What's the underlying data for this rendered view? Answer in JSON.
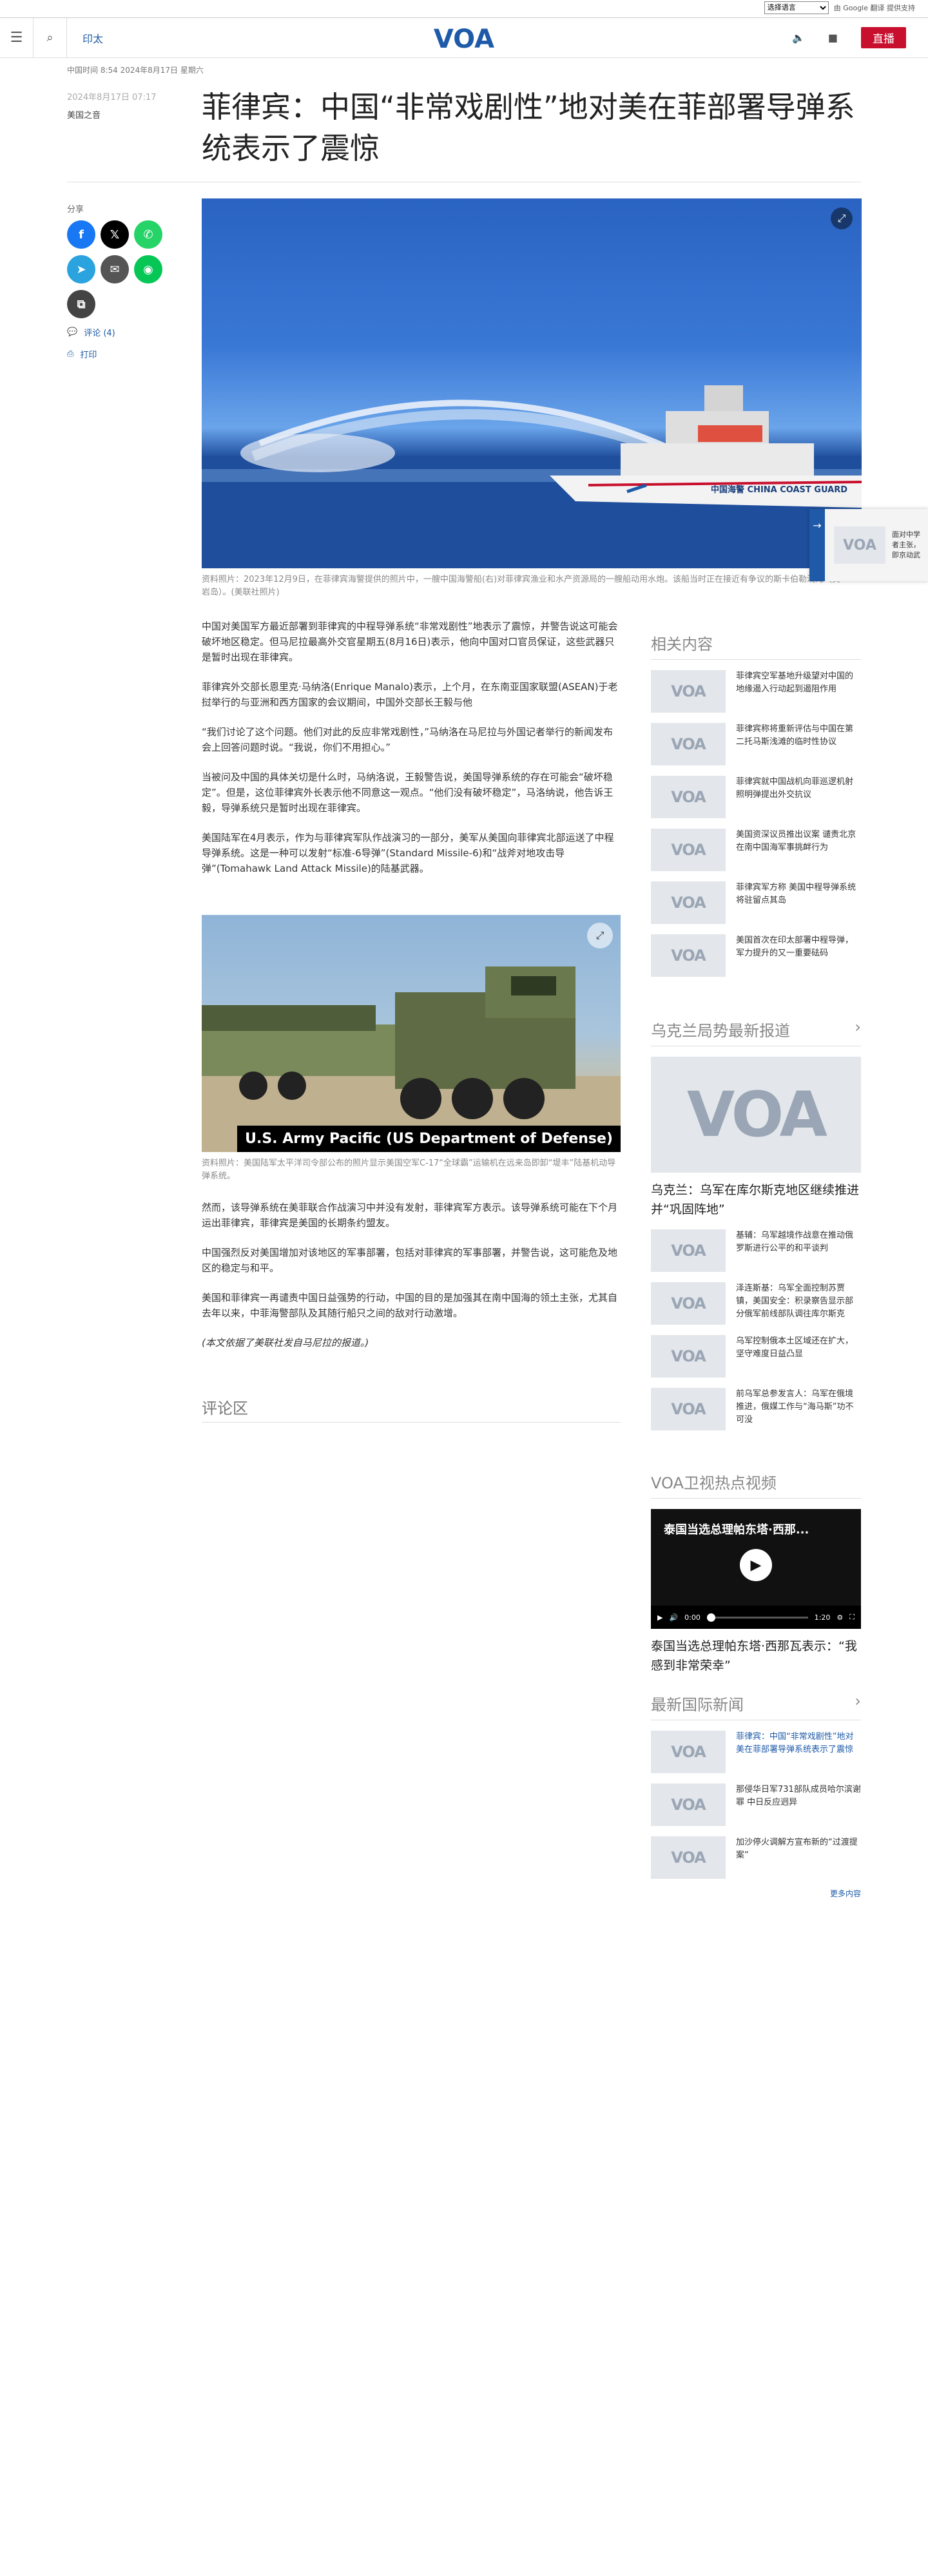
{
  "topbar": {
    "language_select": "选择语言",
    "translate_label": "由 Google 翻译 提供支持"
  },
  "header": {
    "section": "印太",
    "logo_text": "VOA",
    "live_label": "直播"
  },
  "article": {
    "dateline": "中国时间 8:54 2024年8月17日 星期六",
    "pub_date": "2024年8月17日 07:17",
    "author": "美国之音",
    "title": "菲律宾：中国“非常戏剧性”地对美在菲部署导弹系统表示了震惊",
    "share_label": "分享",
    "comments_link": "评论 (4)",
    "print_link": "打印",
    "hero_caption": "资料照片：2023年12月9日，在菲律宾海警提供的照片中，一艘中国海警船(右)对菲律宾渔业和水产资源局的一艘船动用水炮。该船当时正在接近有争议的斯卡伯勒浅滩（黄岩岛）。(美联社照片)",
    "hero_ship_label": "中国海警 CHINA COAST GUARD",
    "paragraphs": [
      "中国对美国军方最近部署到菲律宾的中程导弹系统“非常戏剧性”地表示了震惊，并警告说这可能会破坏地区稳定。但马尼拉最高外交官星期五(8月16日)表示，他向中国对口官员保证，这些武器只是暂时出现在菲律宾。",
      "菲律宾外交部长恩里克·马纳洛(Enrique Manalo)表示，上个月，在东南亚国家联盟(ASEAN)于老挝举行的与亚洲和西方国家的会议期间，中国外交部长王毅与他",
      "“我们讨论了这个问题。他们对此的反应非常戏剧性，”马纳洛在马尼拉与外国记者举行的新闻发布会上回答问题时说。“我说，你们不用担心。”",
      "当被问及中国的具体关切是什么时，马纳洛说，王毅警告说，美国导弹系统的存在可能会“破坏稳定”。但是，这位菲律宾外长表示他不同意这一观点。“他们没有破坏稳定”，马洛纳说，他告诉王毅，导弹系统只是暂时出现在菲律宾。",
      "美国陆军在4月表示，作为与菲律宾军队作战演习的一部分，美军从美国向菲律宾北部运送了中程导弹系统。这是一种可以发射“标准-6导弹”(Standard Missile-6)和“战斧对地攻击导弹”(Tomahawk Land Attack Missile)的陆基武器。"
    ],
    "inline_badge": "U.S. Army Pacific (US Department of Defense)",
    "inline_caption": "资料照片：美国陆军太平洋司令部公布的照片显示美国空军C-17“全球霸”运输机在远来岛即卸“堤丰”陆基机动导弹系统。",
    "paragraphs2": [
      "然而，该导弹系统在美菲联合作战演习中并没有发射，菲律宾军方表示。该导弹系统可能在下个月运出菲律宾，菲律宾是美国的长期条约盟友。",
      "中国强烈反对美国增加对该地区的军事部署，包括对菲律宾的军事部署，并警告说，这可能危及地区的稳定与和平。",
      "美国和菲律宾一再谴责中国日益强势的行动，中国的目的是加强其在南中国海的领土主张，尤其自去年以来，中菲海警部队及其随行船只之间的敌对行动激增。"
    ],
    "note": "(本文依据了美联社发自马尼拉的报道。)",
    "comments_title": "评论区"
  },
  "sidebar": {
    "related_title": "相关内容",
    "related": [
      "菲律宾空军基地升级望对中国的地缘遏入行动起到遏阻作用",
      "菲律宾称将重新评估与中国在第二托马斯浅滩的临时性协议",
      "菲律宾就中国战机向菲巡逻机射照明弹提出外交抗议",
      "美国资深议员推出议案 谴责北京在南中国海军事挑衅行为",
      "菲律宾军方称 美国中程导弹系统将驻留点其岛",
      "美国首次在印太部署中程导弹，军力提升的又一重要砝码"
    ],
    "ukraine_title": "乌克兰局势最新报道",
    "ukraine_lead": "乌克兰：乌军在库尔斯克地区继续推进并“巩固阵地”",
    "ukraine": [
      "基辅：乌军越境作战意在推动俄罗斯进行公平的和平谈判",
      "泽连斯基：乌军全面控制苏贾镇，美国安全：积录察告显示部分俄军前线部队调往库尔斯克",
      "乌军控制俄本土区域还在扩大，坚守难度日益凸显",
      "前乌军总参发言人：乌军在俄境推进，俄媒工作与“海马斯”功不可没"
    ],
    "video_title": "VOA卫视热点视频",
    "video_overlay": "泰国当选总理帕东塔·西那...",
    "video_time_start": "0:00",
    "video_time_end": "1:20",
    "video_caption": "泰国当选总理帕东塔·西那瓦表示：“我感到非常荣幸”",
    "intl_title": "最新国际新闻",
    "intl": [
      "菲律宾：中国“非常戏剧性”地对美在菲部署导弹系统表示了震惊",
      "那侵华日军731部队成员哈尔滨谢罪 中日反应迥异",
      "加沙停火调解方宣布新的“过渡提案”"
    ],
    "more": "更多内容"
  },
  "floater": {
    "text": "面对中学者主张，即京动武"
  },
  "colors": {
    "accent": "#1e5aa8",
    "live": "#c8102e"
  }
}
